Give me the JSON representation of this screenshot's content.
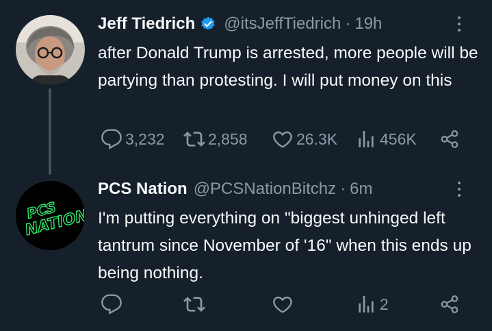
{
  "tweets": [
    {
      "name": "Jeff Tiedrich",
      "verified": true,
      "handle": "@itsJeffTiedrich",
      "separator": "·",
      "time": "19h",
      "text": "after Donald Trump is arrested, more people will be partying than protesting. I will put money on this",
      "replies": "3,232",
      "retweets": "2,858",
      "likes": "26.3K",
      "views": "456K"
    },
    {
      "name": "PCS Nation",
      "handle": "@PCSNationBitchz",
      "separator": "·",
      "time": "6m",
      "avatar_text": "PCS NATION",
      "text": "I'm putting everything on \"biggest unhinged left tantrum since November of '16\" when this ends up being nothing.",
      "replies": "",
      "retweets": "",
      "likes": "",
      "views": "2"
    }
  ],
  "colors": {
    "background": "#15202b",
    "text": "#f7f9f9",
    "secondary": "#8b98a5",
    "verified": "#1d9bf0",
    "avatar_logo": "#2ee86b",
    "thread_line": "#435260"
  }
}
